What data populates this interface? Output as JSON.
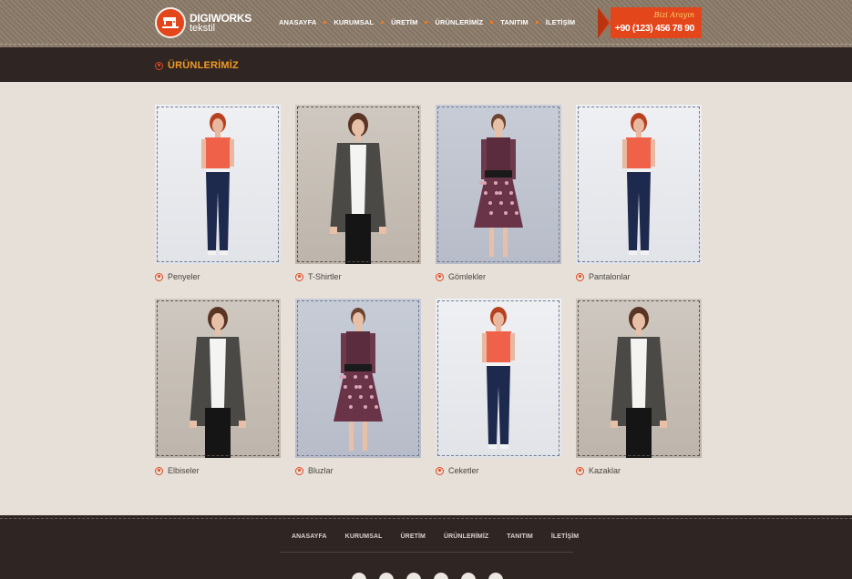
{
  "brand": {
    "name": "DIGIWORKS",
    "sub": "tekstil"
  },
  "nav": [
    "ANASAYFA",
    "KURUMSAL",
    "ÜRETİM",
    "ÜRÜNLERİMİZ",
    "TANITIM",
    "İLETİŞİM"
  ],
  "call": {
    "title": "Bizi Arayın",
    "phone": "+90 (123) 456 78 90"
  },
  "section_title": "ÜRÜNLERİMİZ",
  "products": [
    {
      "label": "Penyeler",
      "model": "top-pants"
    },
    {
      "label": "T-Shirtler",
      "model": "jacket"
    },
    {
      "label": "Gömlekler",
      "model": "dress"
    },
    {
      "label": "Pantalonlar",
      "model": "top-pants"
    },
    {
      "label": "Elbiseler",
      "model": "jacket"
    },
    {
      "label": "Bluzlar",
      "model": "dress"
    },
    {
      "label": "Ceketler",
      "model": "top-pants"
    },
    {
      "label": "Kazaklar",
      "model": "jacket"
    }
  ],
  "footer_nav": [
    "ANASAYFA",
    "KURUMSAL",
    "ÜRETİM",
    "ÜRÜNLERİMİZ",
    "TANITIM",
    "İLETİŞİM"
  ],
  "colors": {
    "accent": "#e4461c",
    "title": "#f39a21",
    "dark": "#2f2624",
    "bg": "#e6e0d9"
  }
}
